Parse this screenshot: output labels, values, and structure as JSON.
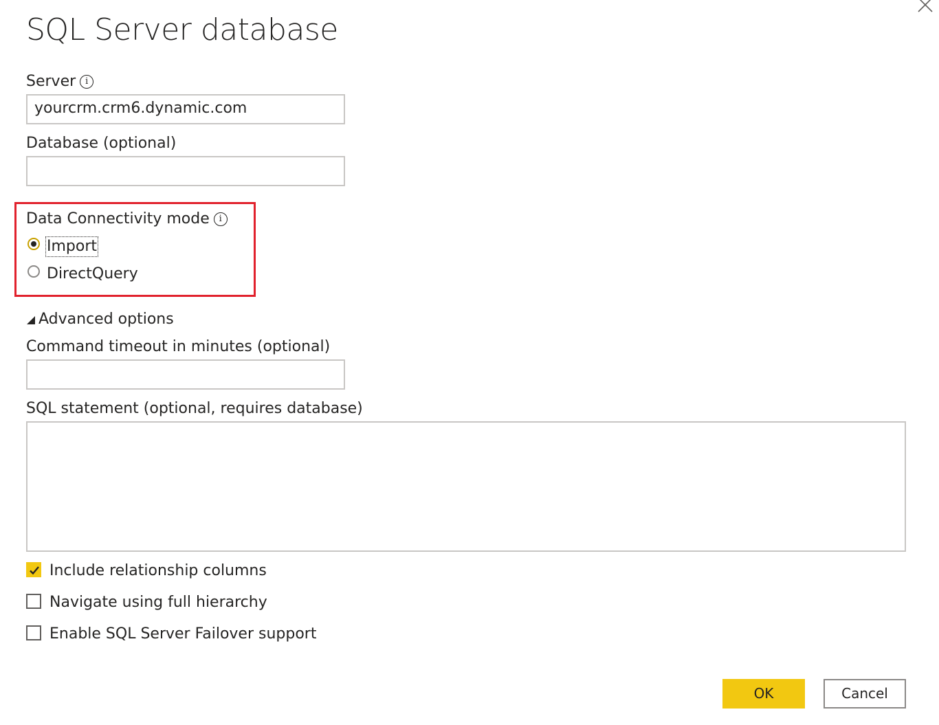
{
  "dialog": {
    "title": "SQL Server database"
  },
  "server": {
    "label": "Server",
    "value": "yourcrm.crm6.dynamic.com"
  },
  "database": {
    "label": "Database (optional)",
    "value": ""
  },
  "connectivity": {
    "label": "Data Connectivity mode",
    "options": [
      {
        "label": "Import",
        "selected": true
      },
      {
        "label": "DirectQuery",
        "selected": false
      }
    ]
  },
  "advanced": {
    "toggle_label": "Advanced options",
    "timeout_label": "Command timeout in minutes (optional)",
    "timeout_value": "",
    "sql_label": "SQL statement (optional, requires database)",
    "sql_value": ""
  },
  "checkboxes": [
    {
      "label": "Include relationship columns",
      "checked": true
    },
    {
      "label": "Navigate using full hierarchy",
      "checked": false
    },
    {
      "label": "Enable SQL Server Failover support",
      "checked": false
    }
  ],
  "buttons": {
    "ok": "OK",
    "cancel": "Cancel"
  },
  "icons": {
    "close": "close-icon",
    "info": "info-icon",
    "expand": "triangle-expand-icon"
  },
  "colors": {
    "accent": "#f2c811",
    "highlight_box": "#e1212c"
  }
}
